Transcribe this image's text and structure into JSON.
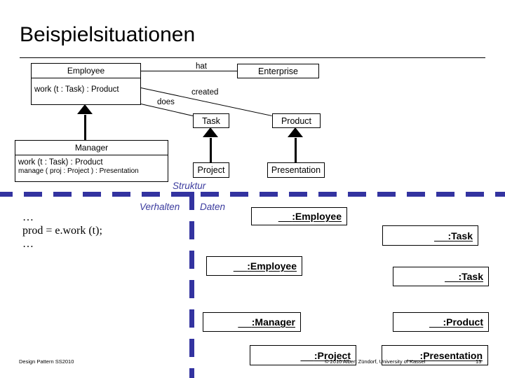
{
  "slide": {
    "title": "Beispielsituationen",
    "footer_left": "Design Pattern SS2010",
    "footer_copyright": "© 2010 Albert Zündorf, University of Kassel",
    "footer_page": "13"
  },
  "colors": {
    "divider_blue": "#3333a0",
    "zone_label_blue": "#3b3b9e",
    "line_black": "#000000",
    "background": "#ffffff"
  },
  "class_diagram": {
    "classes": [
      {
        "id": "employee",
        "name": "Employee",
        "operations": [
          "work (t : Task) : Product"
        ]
      },
      {
        "id": "manager",
        "name": "Manager",
        "operations": [
          "work (t : Task) : Product",
          "manage ( proj : Project ) : Presentation"
        ]
      }
    ],
    "simple_classes": [
      {
        "id": "enterprise",
        "name": "Enterprise"
      },
      {
        "id": "task",
        "name": "Task"
      },
      {
        "id": "product",
        "name": "Product"
      },
      {
        "id": "project",
        "name": "Project"
      },
      {
        "id": "presentation",
        "name": "Presentation"
      }
    ],
    "associations": [
      {
        "id": "hat",
        "label": "hat",
        "from": "Employee",
        "to": "Enterprise"
      },
      {
        "id": "created",
        "label": "created",
        "from": "Employee",
        "to": "Product"
      },
      {
        "id": "does",
        "label": "does",
        "from": "Employee",
        "to": "Task"
      }
    ],
    "generalizations": [
      {
        "from": "Manager",
        "to": "Employee"
      },
      {
        "from": "Project",
        "to": "Task"
      },
      {
        "from": "Presentation",
        "to": "Product"
      }
    ]
  },
  "zones": {
    "struktur": "Struktur",
    "verhalten": "Verhalten",
    "daten": "Daten"
  },
  "code": {
    "ellipsis_top": "…",
    "statement": "prod = e.work (t);",
    "ellipsis_bottom": "…"
  },
  "objects": [
    {
      "id": "obj-employee-1",
      "name": ":Employee"
    },
    {
      "id": "obj-task-1",
      "name": ":Task"
    },
    {
      "id": "obj-employee-2",
      "name": ":Employee"
    },
    {
      "id": "obj-task-2",
      "name": ":Task"
    },
    {
      "id": "obj-manager",
      "name": ":Manager"
    },
    {
      "id": "obj-product",
      "name": ":Product"
    },
    {
      "id": "obj-project",
      "name": ":Project"
    },
    {
      "id": "obj-presentation",
      "name": ":Presentation"
    }
  ]
}
